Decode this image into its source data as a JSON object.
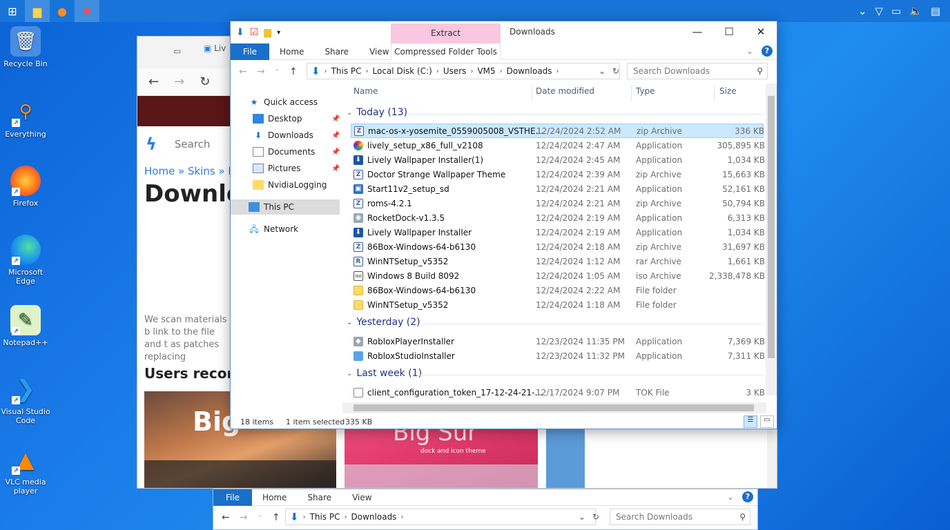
{
  "desktop_icons": [
    {
      "label": "Recycle Bin",
      "icon": "recycle-bin-icon"
    },
    {
      "label": "Everything",
      "icon": "search-app-icon"
    },
    {
      "label": "Firefox",
      "icon": "firefox-icon"
    },
    {
      "label": "Microsoft Edge",
      "icon": "edge-icon"
    },
    {
      "label": "Notepad++",
      "icon": "notepad-icon"
    },
    {
      "label": "Visual Studio Code",
      "icon": "vscode-icon"
    },
    {
      "label": "VLC media player",
      "icon": "vlc-icon"
    }
  ],
  "browser": {
    "tab_label": "Liv",
    "search_placeholder": "Search",
    "breadcrumb": "Home » Skins » Ro",
    "title": "Downlo",
    "paragraph": "We scan materials b link to the file and t as patches replacing",
    "users_heading": "Users recomm",
    "thumb1_text": "Big",
    "thumb2_text": "Big Sur",
    "thumb2_sub": "dock and icon theme"
  },
  "explorer": {
    "extract_label": "Extract",
    "window_title": "Downloads",
    "ribbon": {
      "file": "File",
      "tabs": [
        "Home",
        "Share",
        "View"
      ],
      "compressed": "Compressed Folder Tools"
    },
    "address": [
      "This PC",
      "Local Disk (C:)",
      "Users",
      "VM5",
      "Downloads"
    ],
    "search_placeholder": "Search Downloads",
    "nav": {
      "quick_access": "Quick access",
      "desktop": "Desktop",
      "downloads": "Downloads",
      "documents": "Documents",
      "pictures": "Pictures",
      "nvidia": "NvidiaLogging",
      "this_pc": "This PC",
      "network": "Network"
    },
    "columns": {
      "name": "Name",
      "date": "Date modified",
      "type": "Type",
      "size": "Size"
    },
    "groups": {
      "today": "Today (13)",
      "yesterday": "Yesterday (2)",
      "last_week": "Last week (1)"
    },
    "files_today": [
      {
        "name": "mac-os-x-yosemite_0559005008_VSTHE...",
        "date": "12/24/2024 2:52 AM",
        "type": "zip Archive",
        "size": "336 KB"
      },
      {
        "name": "lively_setup_x86_full_v2108",
        "date": "12/24/2024 2:47 AM",
        "type": "Application",
        "size": "305,895 KB"
      },
      {
        "name": "Lively Wallpaper Installer(1)",
        "date": "12/24/2024 2:45 AM",
        "type": "Application",
        "size": "1,034 KB"
      },
      {
        "name": "Doctor Strange Wallpaper Theme",
        "date": "12/24/2024 2:39 AM",
        "type": "zip Archive",
        "size": "15,663 KB"
      },
      {
        "name": "Start11v2_setup_sd",
        "date": "12/24/2024 2:21 AM",
        "type": "Application",
        "size": "52,161 KB"
      },
      {
        "name": "roms-4.2.1",
        "date": "12/24/2024 2:21 AM",
        "type": "zip Archive",
        "size": "50,794 KB"
      },
      {
        "name": "RocketDock-v1.3.5",
        "date": "12/24/2024 2:19 AM",
        "type": "Application",
        "size": "6,313 KB"
      },
      {
        "name": "Lively Wallpaper Installer",
        "date": "12/24/2024 2:19 AM",
        "type": "Application",
        "size": "1,034 KB"
      },
      {
        "name": "86Box-Windows-64-b6130",
        "date": "12/24/2024 2:18 AM",
        "type": "zip Archive",
        "size": "31,697 KB"
      },
      {
        "name": "WinNTSetup_v5352",
        "date": "12/24/2024 1:12 AM",
        "type": "rar Archive",
        "size": "1,661 KB"
      },
      {
        "name": "Windows 8 Build 8092",
        "date": "12/24/2024 1:05 AM",
        "type": "iso Archive",
        "size": "2,338,478 KB"
      },
      {
        "name": "86Box-Windows-64-b6130",
        "date": "12/24/2024 2:22 AM",
        "type": "File folder",
        "size": ""
      },
      {
        "name": "WinNTSetup_v5352",
        "date": "12/24/2024 1:18 AM",
        "type": "File folder",
        "size": ""
      }
    ],
    "files_yesterday": [
      {
        "name": "RobloxPlayerInstaller",
        "date": "12/23/2024 11:35 PM",
        "type": "Application",
        "size": "7,369 KB"
      },
      {
        "name": "RobloxStudioInstaller",
        "date": "12/23/2024 11:32 PM",
        "type": "Application",
        "size": "7,311 KB"
      }
    ],
    "files_last_week": [
      {
        "name": "client_configuration_token_17-12-24-21-...",
        "date": "12/17/2024 9:07 PM",
        "type": "TOK File",
        "size": "3 KB"
      }
    ],
    "status": {
      "items": "18 items",
      "selected": "1 item selected",
      "size": "335 KB"
    }
  },
  "explorer2": {
    "address": [
      "This PC",
      "Downloads"
    ],
    "search_placeholder": "Search Downloads"
  }
}
